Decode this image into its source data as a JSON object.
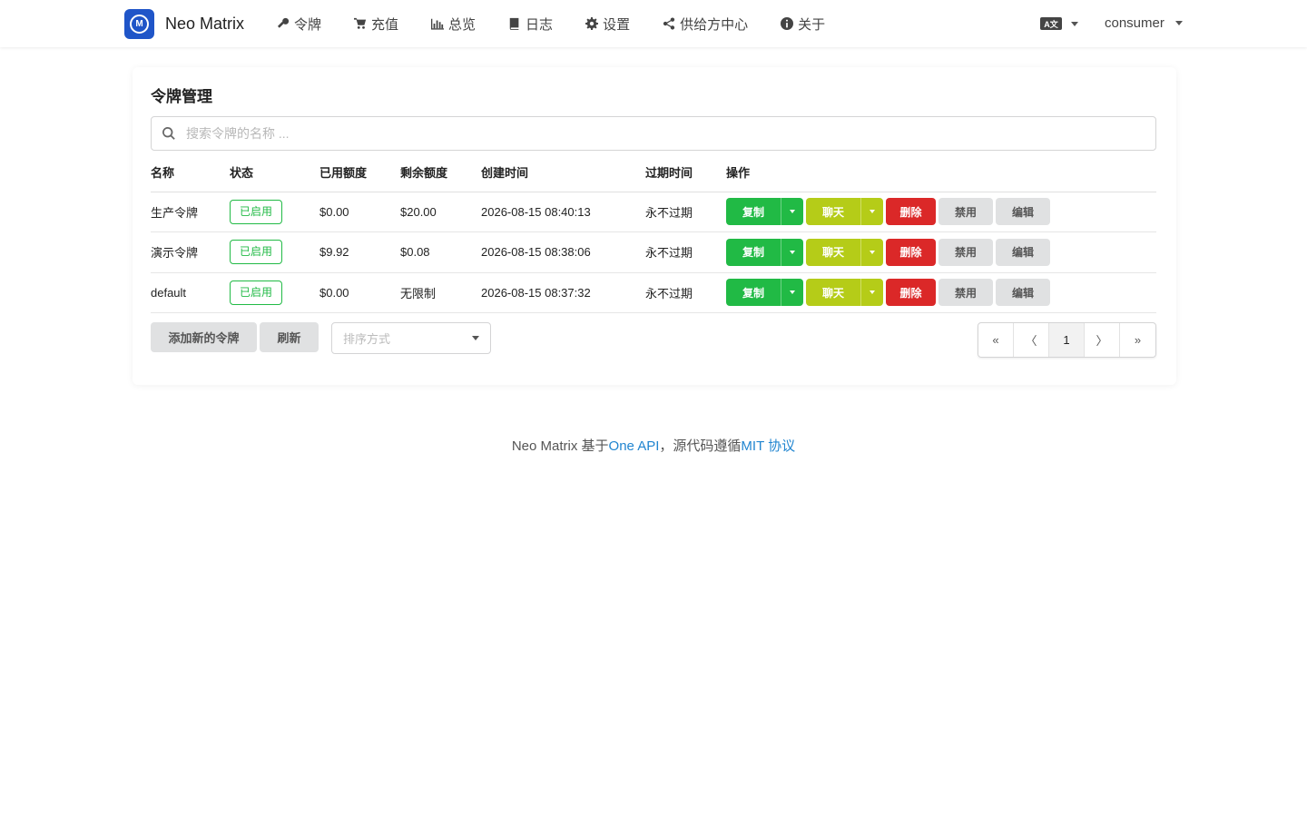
{
  "header": {
    "brand": "Neo Matrix",
    "nav": [
      {
        "label": "令牌",
        "icon": "key-icon"
      },
      {
        "label": "充值",
        "icon": "cart-icon"
      },
      {
        "label": "总览",
        "icon": "bar-chart-icon"
      },
      {
        "label": "日志",
        "icon": "book-icon"
      },
      {
        "label": "设置",
        "icon": "gear-icon"
      },
      {
        "label": "供给方中心",
        "icon": "share-icon"
      },
      {
        "label": "关于",
        "icon": "info-icon"
      }
    ],
    "lang_icon": "translate-icon",
    "user": "consumer"
  },
  "page": {
    "title": "令牌管理",
    "search_placeholder": "搜索令牌的名称 ..."
  },
  "table": {
    "headers": [
      "名称",
      "状态",
      "已用额度",
      "剩余额度",
      "创建时间",
      "过期时间",
      "操作"
    ],
    "rows": [
      {
        "name": "生产令牌",
        "status": "已启用",
        "used": "$0.00",
        "remaining": "$20.00",
        "created": "2026-08-15 08:40:13",
        "expires": "永不过期"
      },
      {
        "name": "演示令牌",
        "status": "已启用",
        "used": "$9.92",
        "remaining": "$0.08",
        "created": "2026-08-15 08:38:06",
        "expires": "永不过期"
      },
      {
        "name": "default",
        "status": "已启用",
        "used": "$0.00",
        "remaining": "无限制",
        "created": "2026-08-15 08:37:32",
        "expires": "永不过期"
      }
    ],
    "actions": {
      "copy": "复制",
      "chat": "聊天",
      "delete": "删除",
      "disable": "禁用",
      "edit": "编辑"
    }
  },
  "toolbar": {
    "add": "添加新的令牌",
    "refresh": "刷新",
    "sort_placeholder": "排序方式"
  },
  "pagination": {
    "first": "«",
    "prev": "〈",
    "current": "1",
    "next": "〉",
    "last": "»"
  },
  "footer": {
    "prefix": "Neo Matrix 基于",
    "link1": "One API",
    "middle": "，源代码遵循",
    "link2": "MIT 协议"
  },
  "colors": {
    "green": "#21ba45",
    "olive": "#b5cc18",
    "red": "#db2828",
    "link": "#2185d0",
    "logo": "#1f55c8"
  }
}
